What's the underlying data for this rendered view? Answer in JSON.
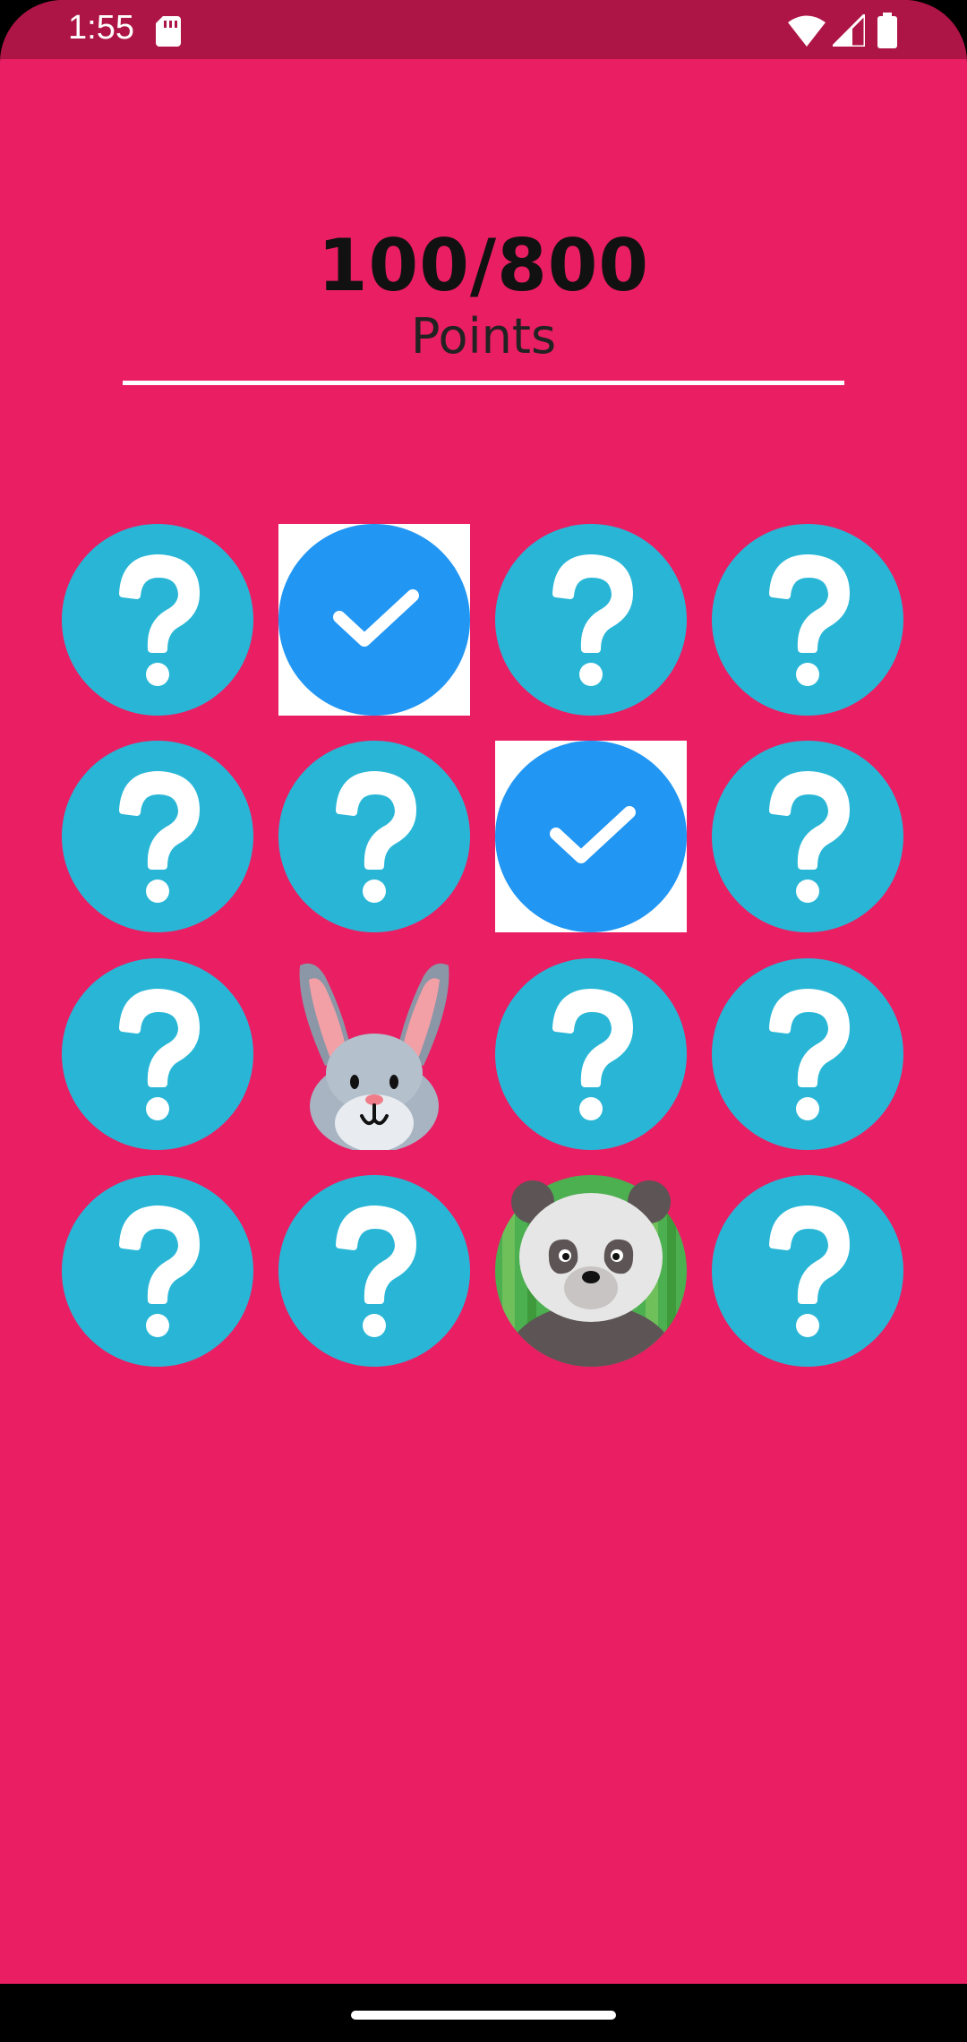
{
  "status_bar": {
    "time": "1:55",
    "icons": [
      "sd-card-icon",
      "wifi-icon",
      "signal-icon",
      "battery-icon"
    ],
    "background": "#AD1547"
  },
  "game": {
    "score": "100/800",
    "score_label": "Points",
    "background": "#E91E63",
    "tile_colors": {
      "hidden": "#29B6D6",
      "matched": "#2196F3"
    },
    "board": [
      [
        "hidden",
        "matched",
        "hidden",
        "hidden"
      ],
      [
        "hidden",
        "hidden",
        "matched",
        "hidden"
      ],
      [
        "hidden",
        "rabbit",
        "hidden",
        "hidden"
      ],
      [
        "hidden",
        "hidden",
        "panda",
        "hidden"
      ]
    ]
  }
}
